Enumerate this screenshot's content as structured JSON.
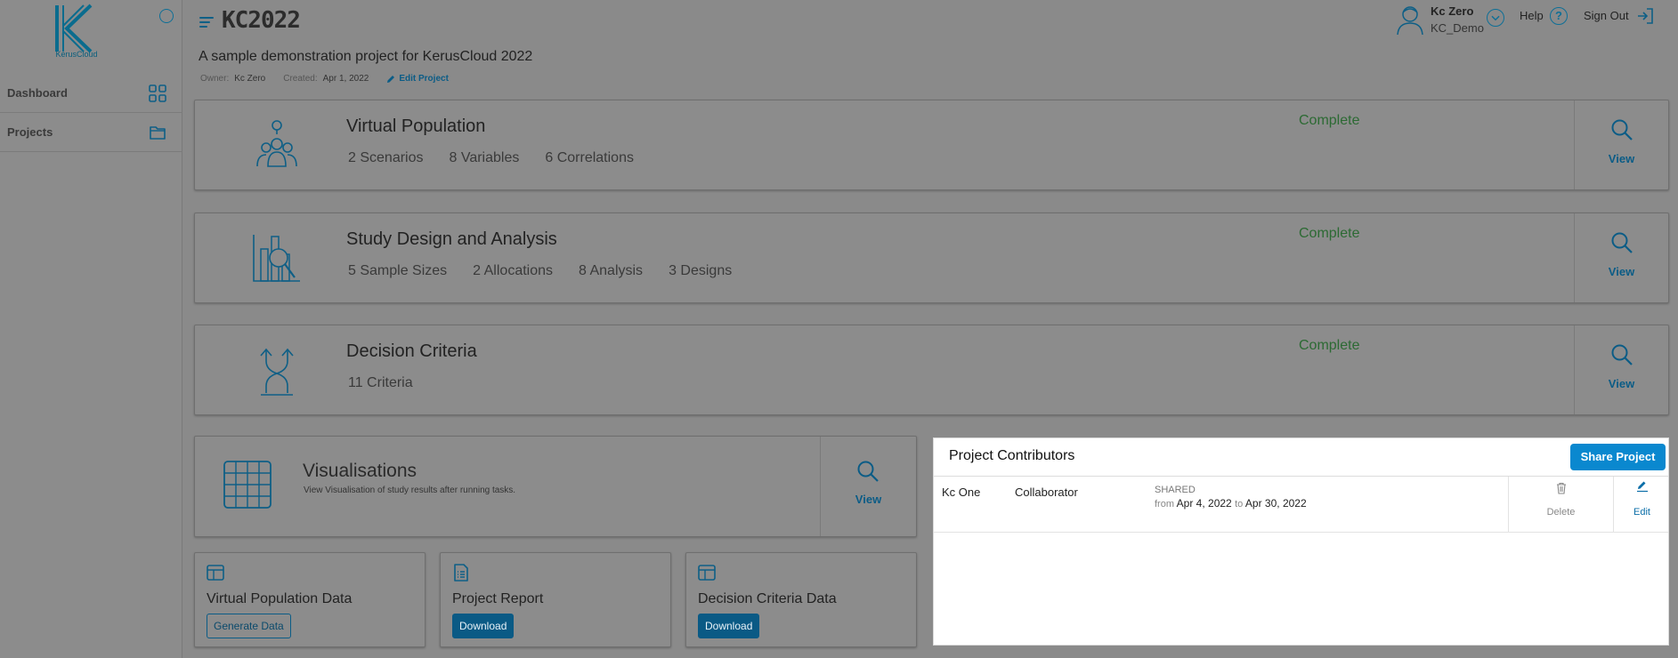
{
  "sidebar": {
    "logo_text": "KerusCloud",
    "items": [
      {
        "label": "Dashboard",
        "icon": "grid-icon"
      },
      {
        "label": "Projects",
        "icon": "folder-icon"
      }
    ]
  },
  "header": {
    "title": "KC2022",
    "description": "A sample demonstration project for KerusCloud 2022",
    "owner_label": "Owner:",
    "owner": "Kc Zero",
    "created_label": "Created:",
    "created": "Apr 1, 2022",
    "edit_label": "Edit Project"
  },
  "user": {
    "name": "Kc Zero",
    "org": "KC_Demo",
    "help_label": "Help",
    "signout_label": "Sign Out"
  },
  "stages": [
    {
      "title": "Virtual Population",
      "stats": [
        "2 Scenarios",
        "8 Variables",
        "6 Correlations"
      ],
      "status": "Complete",
      "view_label": "View",
      "icon": "population-icon"
    },
    {
      "title": "Study Design and Analysis",
      "stats": [
        "5 Sample Sizes",
        "2 Allocations",
        "8 Analysis",
        "3 Designs"
      ],
      "status": "Complete",
      "view_label": "View",
      "icon": "study-design-icon"
    },
    {
      "title": "Decision Criteria",
      "stats": [
        "11 Criteria"
      ],
      "status": "Complete",
      "view_label": "View",
      "icon": "decision-icon"
    }
  ],
  "visualisations": {
    "title": "Visualisations",
    "subtitle": "View Visualisation of study results after running tasks.",
    "view_label": "View"
  },
  "tiles": [
    {
      "title": "Virtual Population Data",
      "button": "Generate Data"
    },
    {
      "title": "Project Report",
      "button": "Download"
    },
    {
      "title": "Decision Criteria Data",
      "button": "Download"
    }
  ],
  "contributors": {
    "title": "Project Contributors",
    "share_label": "Share Project",
    "rows": [
      {
        "name": "Kc One",
        "role": "Collaborator",
        "shared": "SHARED",
        "from_label": "from",
        "from": "Apr 4, 2022",
        "to_label": "to",
        "to": "Apr 30, 2022",
        "delete_label": "Delete",
        "edit_label": "Edit"
      }
    ]
  },
  "colors": {
    "accent": "#0a88cf",
    "complete": "#2c6a33",
    "link": "#0b5c86"
  }
}
